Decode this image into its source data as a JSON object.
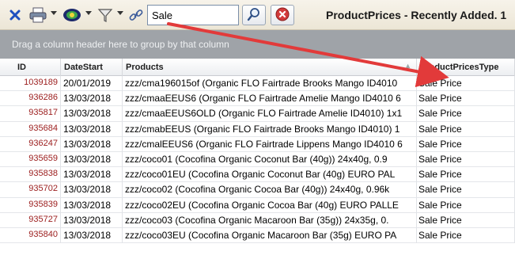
{
  "toolbar": {
    "search_value": "Sale",
    "window_title": "ProductPrices - Recently Added. 1",
    "colors": {
      "close": "#1e4fbf",
      "clear": "#d23b3b",
      "arrow": "#e23a3a"
    },
    "icons": [
      "close-icon",
      "print-icon",
      "view-icon",
      "filter-icon",
      "link-icon",
      "search-icon",
      "clear-icon"
    ]
  },
  "group_panel": {
    "text": "Drag a column header here to group by that column"
  },
  "grid": {
    "columns": [
      "ID",
      "DateStart",
      "Products",
      "ProductPricesType"
    ],
    "rows": [
      [
        "1039189",
        "20/01/2019",
        "zzz/cma196015of (Organic FLO Fairtrade Brooks Mango ID4010",
        "Sale Price"
      ],
      [
        "936286",
        "13/03/2018",
        "zzz/cmaaEEUS6 (Organic FLO Fairtrade Amelie Mango ID4010 6",
        "Sale Price"
      ],
      [
        "935817",
        "13/03/2018",
        "zzz/cmaaEEUS6OLD (Organic FLO Fairtrade Amelie ID4010) 1x1",
        "Sale Price"
      ],
      [
        "935684",
        "13/03/2018",
        "zzz/cmabEEUS (Organic FLO Fairtrade Brooks Mango ID4010) 1",
        "Sale Price"
      ],
      [
        "936247",
        "13/03/2018",
        "zzz/cmalEEUS6 (Organic FLO Fairtrade Lippens Mango ID4010 6",
        "Sale Price"
      ],
      [
        "935659",
        "13/03/2018",
        "zzz/coco01 (Cocofina Organic Coconut Bar (40g)) 24x40g, 0.9",
        "Sale Price"
      ],
      [
        "935838",
        "13/03/2018",
        "zzz/coco01EU (Cocofina Organic Coconut Bar (40g) EURO PAL",
        "Sale Price"
      ],
      [
        "935702",
        "13/03/2018",
        "zzz/coco02 (Cocofina Organic Cocoa Bar (40g)) 24x40g, 0.96k",
        "Sale Price"
      ],
      [
        "935839",
        "13/03/2018",
        "zzz/coco02EU (Cocofina Organic Cocoa Bar (40g) EURO PALLE",
        "Sale Price"
      ],
      [
        "935727",
        "13/03/2018",
        "zzz/coco03 (Cocofina Organic Macaroon Bar (35g)) 24x35g, 0.",
        "Sale Price"
      ],
      [
        "935840",
        "13/03/2018",
        "zzz/coco03EU (Cocofina Organic Macaroon Bar (35g) EURO PA",
        "Sale Price"
      ]
    ]
  }
}
